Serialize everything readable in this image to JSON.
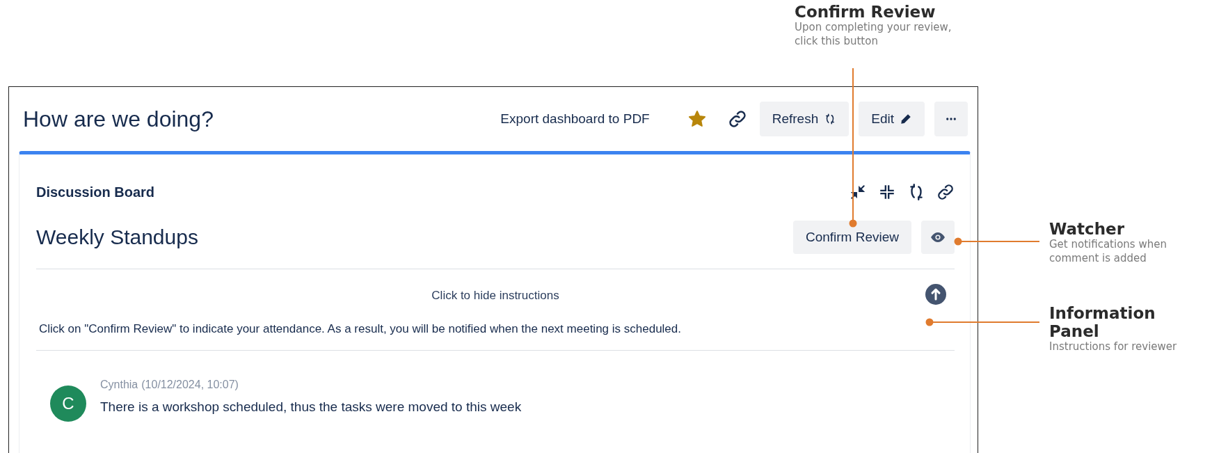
{
  "dashboard": {
    "title": "How are we doing?",
    "export_link": "Export dashboard to PDF",
    "starred": true,
    "refresh_button": "Refresh",
    "edit_button": "Edit"
  },
  "gadget": {
    "type_label": "Discussion Board",
    "title": "Weekly Standups",
    "confirm_button": "Confirm Review",
    "instructions": {
      "toggle": "Click to hide instructions",
      "expanded": true,
      "text": "Click on \"Confirm Review\" to indicate your attendance. As a result, you will be notified when the next meeting is scheduled."
    },
    "comments": [
      {
        "author": "Cynthia",
        "timestamp": "(10/12/2024, 10:07)",
        "initial": "C",
        "color": "#1f8a5b",
        "text": "There is a workshop scheduled, thus the tasks were moved to this week"
      }
    ]
  },
  "annotations": [
    {
      "title": "Confirm Review",
      "description": "Upon completing your review, click this button"
    },
    {
      "title": "Watcher",
      "description": "Get notifications when comment is added"
    },
    {
      "title": "Information Panel",
      "description": "Instructions for reviewer"
    }
  ]
}
